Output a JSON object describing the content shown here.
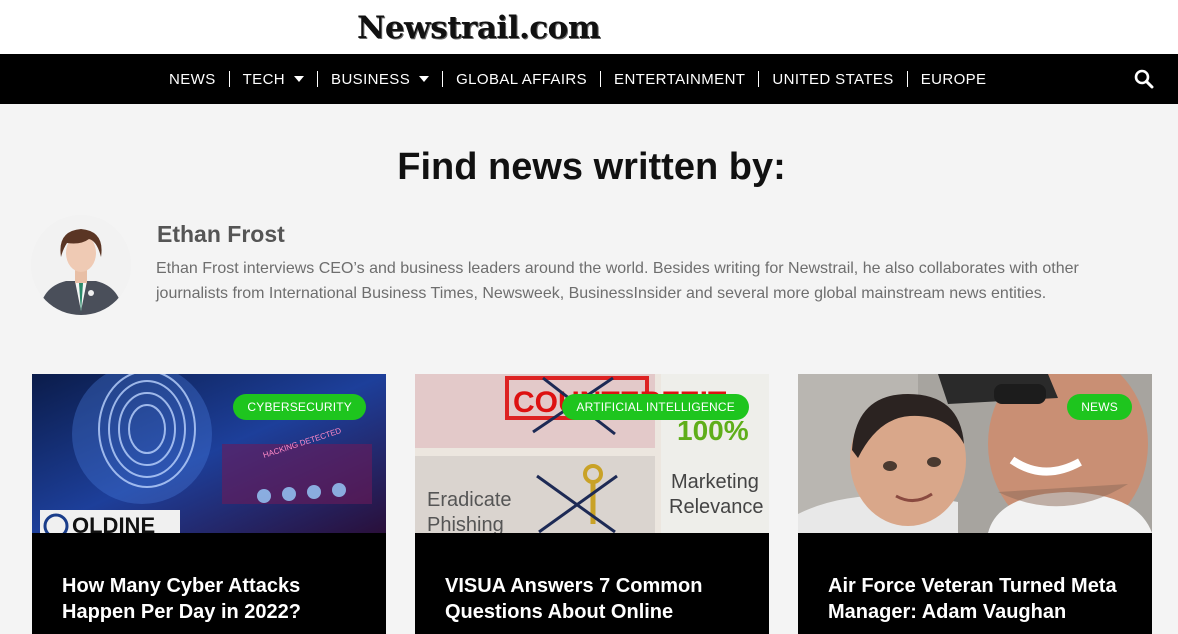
{
  "header": {
    "logo_text": "Newstrail.com"
  },
  "nav": {
    "items": [
      {
        "label": "NEWS",
        "dropdown": false
      },
      {
        "label": "TECH",
        "dropdown": true
      },
      {
        "label": "BUSINESS",
        "dropdown": true
      },
      {
        "label": "GLOBAL AFFAIRS",
        "dropdown": false
      },
      {
        "label": "ENTERTAINMENT",
        "dropdown": false
      },
      {
        "label": "UNITED STATES",
        "dropdown": false
      },
      {
        "label": "EUROPE",
        "dropdown": false
      }
    ],
    "search_icon": "search-icon"
  },
  "page": {
    "heading": "Find news written by:"
  },
  "author": {
    "name": "Ethan Frost",
    "bio": "Ethan Frost interviews CEO’s and business leaders around the world. Besides writing for Newstrail, he also collaborates with other journalists from International Business Times, Newsweek, BusinessInsider and several more global mainstream news entities."
  },
  "cards": [
    {
      "category": "CYBERSECURITY",
      "title": "How Many Cyber Attacks Happen Per Day in 2022?",
      "image_text": [
        "HACKING DETECTED",
        "OLDINE"
      ]
    },
    {
      "category": "ARTIFICIAL INTELLIGENCE",
      "title": "VISUA Answers 7 Common Questions About Online",
      "image_text": [
        "COUNTERFEIT",
        "100%",
        "Marketing",
        "Relevance",
        "Eradicate",
        "Phishing"
      ]
    },
    {
      "category": "NEWS",
      "title": "Air Force Veteran Turned Meta Manager: Adam Vaughan",
      "image_text": []
    }
  ],
  "colors": {
    "nav_bg": "#000000",
    "badge": "#1ec51e",
    "card_bg": "#000000",
    "page_bg": "#f4f4f4"
  }
}
